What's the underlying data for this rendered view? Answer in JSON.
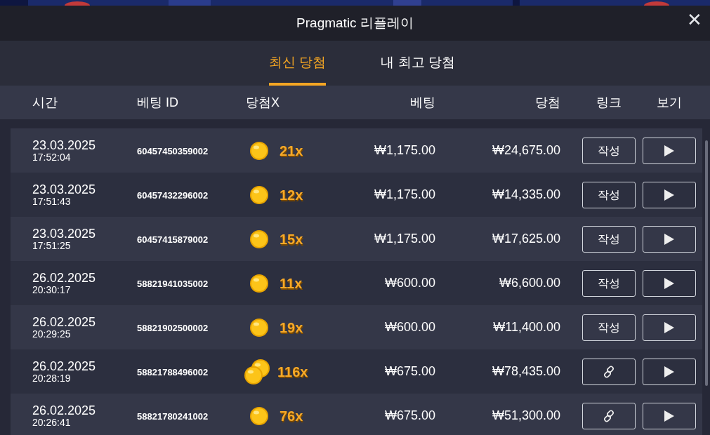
{
  "window": {
    "title": "Pragmatic 리플레이",
    "close": "✕"
  },
  "tabs": [
    {
      "label": "최신 당첨",
      "selected": true
    },
    {
      "label": "내 최고 당첨",
      "selected": false
    }
  ],
  "table": {
    "columns": [
      "시간",
      "베팅 ID",
      "당첨X",
      "베팅",
      "당첨",
      "링크",
      "보기"
    ],
    "rows": [
      {
        "date": "23.03.2025",
        "time": "17:52:04",
        "bet_id": "60457450359002",
        "kind": "single",
        "multiplier": "21x",
        "bet": "₩1,175.00",
        "win": "₩24,675.00",
        "link": {
          "kind": "text",
          "label": "작성"
        }
      },
      {
        "date": "23.03.2025",
        "time": "17:51:43",
        "bet_id": "60457432296002",
        "kind": "single",
        "multiplier": "12x",
        "bet": "₩1,175.00",
        "win": "₩14,335.00",
        "link": {
          "kind": "text",
          "label": "작성"
        }
      },
      {
        "date": "23.03.2025",
        "time": "17:51:25",
        "bet_id": "60457415879002",
        "kind": "single",
        "multiplier": "15x",
        "bet": "₩1,175.00",
        "win": "₩17,625.00",
        "link": {
          "kind": "text",
          "label": "작성"
        }
      },
      {
        "date": "26.02.2025",
        "time": "20:30:17",
        "bet_id": "58821941035002",
        "kind": "single",
        "multiplier": "11x",
        "bet": "₩600.00",
        "win": "₩6,600.00",
        "link": {
          "kind": "text",
          "label": "작성"
        }
      },
      {
        "date": "26.02.2025",
        "time": "20:29:25",
        "bet_id": "58821902500002",
        "kind": "single",
        "multiplier": "19x",
        "bet": "₩600.00",
        "win": "₩11,400.00",
        "link": {
          "kind": "text",
          "label": "작성"
        }
      },
      {
        "date": "26.02.2025",
        "time": "20:28:19",
        "bet_id": "58821788496002",
        "kind": "double",
        "multiplier": "116x",
        "bet": "₩675.00",
        "win": "₩78,435.00",
        "link": {
          "kind": "icon"
        }
      },
      {
        "date": "26.02.2025",
        "time": "20:26:41",
        "bet_id": "58821780241002",
        "kind": "single",
        "multiplier": "76x",
        "bet": "₩675.00",
        "win": "₩51,300.00",
        "link": {
          "kind": "icon"
        }
      }
    ]
  }
}
